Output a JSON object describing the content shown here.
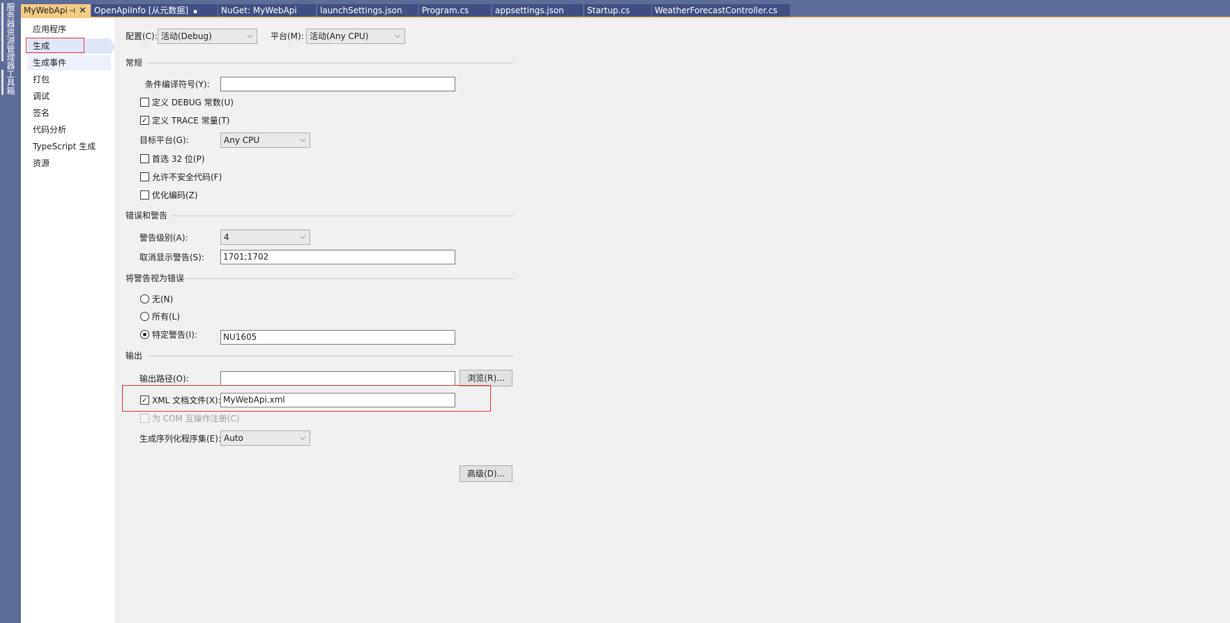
{
  "side_strip": {
    "items": [
      "服务器资源管理器",
      "工具箱"
    ]
  },
  "tabs": [
    {
      "label": "MyWebApi",
      "active": true,
      "pin": "⊣",
      "close": "✕"
    },
    {
      "label": "OpenApiInfo [从元数据]",
      "lock": "🔒"
    },
    {
      "label": "NuGet: MyWebApi"
    },
    {
      "label": "launchSettings.json"
    },
    {
      "label": "Program.cs"
    },
    {
      "label": "appsettings.json"
    },
    {
      "label": "Startup.cs"
    },
    {
      "label": "WeatherForecastController.cs"
    }
  ],
  "nav": {
    "items": [
      "应用程序",
      "生成",
      "生成事件",
      "打包",
      "调试",
      "签名",
      "代码分析",
      "TypeScript 生成",
      "资源"
    ],
    "selected": "生成"
  },
  "toolbar": {
    "config_label": "配置(C):",
    "config_value": "活动(Debug)",
    "platform_label": "平台(M):",
    "platform_value": "活动(Any CPU)"
  },
  "general": {
    "title": "常规",
    "symbols_label": "条件编译符号(Y):",
    "symbols_value": "",
    "define_debug": {
      "label": "定义 DEBUG 常数(U)",
      "checked": false
    },
    "define_trace": {
      "label": "定义 TRACE 常量(T)",
      "checked": true
    },
    "target_label": "目标平台(G):",
    "target_value": "Any CPU",
    "prefer32": {
      "label": "首选 32 位(P)",
      "checked": false
    },
    "unsafe": {
      "label": "允许不安全代码(F)",
      "checked": false
    },
    "optimize": {
      "label": "优化编码(Z)",
      "checked": false
    }
  },
  "errors": {
    "title": "错误和警告",
    "level_label": "警告级别(A):",
    "level_value": "4",
    "suppress_label": "取消显示警告(S):",
    "suppress_value": "1701;1702"
  },
  "treat": {
    "title": "将警告视为错误",
    "none": "无(N)",
    "all": "所有(L)",
    "specific": "特定警告(I):",
    "specific_value": "NU1605",
    "selected": "specific"
  },
  "output": {
    "title": "输出",
    "path_label": "输出路径(O):",
    "path_value": "",
    "browse_label": "浏览(R)...",
    "xml_label": "XML 文档文件(X):",
    "xml_checked": true,
    "xml_value": "MyWebApi.xml",
    "com_label": "为 COM 互操作注册(C)",
    "serial_label": "生成序列化程序集(E):",
    "serial_value": "Auto",
    "advanced_label": "高级(D)..."
  },
  "glyphs": {
    "check": "✓",
    "dropdown": "⌵"
  },
  "colors": {
    "chrome": "#5d6b99",
    "active_tab": "#f5cc84",
    "highlight_red": "#e03434"
  }
}
